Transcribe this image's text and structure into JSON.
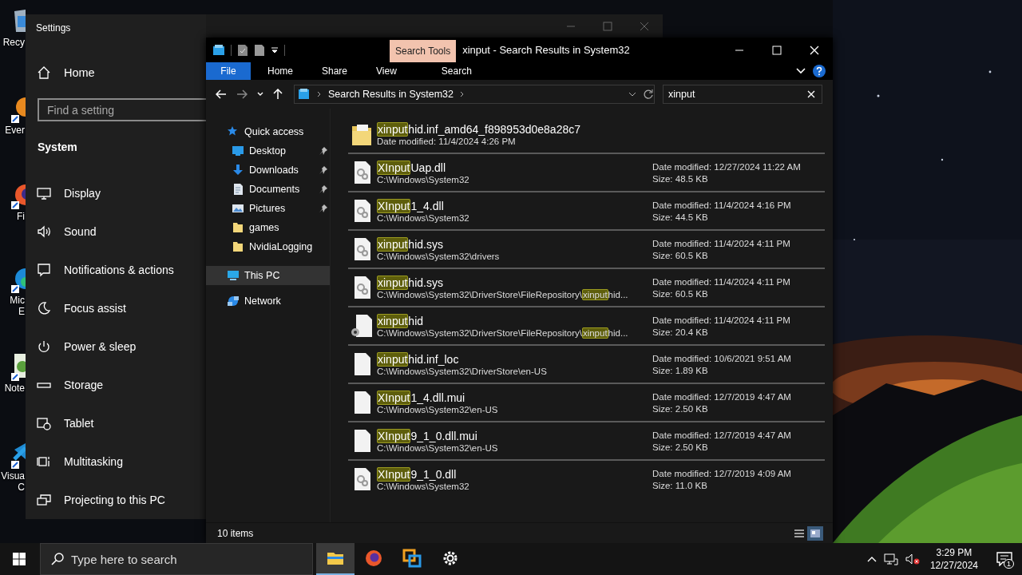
{
  "desktop": {
    "icons": [
      {
        "kind": "bin",
        "lines": [
          "Recy"
        ]
      },
      {
        "kind": "orange",
        "lines": [
          "Ever"
        ]
      },
      {
        "kind": "firefox",
        "lines": [
          "Fi"
        ]
      },
      {
        "kind": "edge",
        "lines": [
          "Mic",
          "E"
        ]
      },
      {
        "kind": "notepad",
        "lines": [
          "Note"
        ]
      },
      {
        "kind": "code",
        "lines": [
          "Visua",
          "C"
        ]
      }
    ]
  },
  "settings": {
    "title": "Settings",
    "home": "Home",
    "search": {
      "placeholder": "Find a setting"
    },
    "section": "System",
    "items": [
      {
        "kind": "display",
        "label": "Display"
      },
      {
        "kind": "sound",
        "label": "Sound"
      },
      {
        "kind": "notifications",
        "label": "Notifications & actions"
      },
      {
        "kind": "focus",
        "label": "Focus assist"
      },
      {
        "kind": "power",
        "label": "Power & sleep"
      },
      {
        "kind": "storage",
        "label": "Storage"
      },
      {
        "kind": "tablet",
        "label": "Tablet"
      },
      {
        "kind": "multitasking",
        "label": "Multitasking"
      },
      {
        "kind": "projecting",
        "label": "Projecting to this PC"
      }
    ]
  },
  "explorer": {
    "context_tab": "Search Tools",
    "title": "xinput - Search Results in System32",
    "ribbon_tabs": [
      {
        "kind": "file",
        "label": "File"
      },
      {
        "kind": "tab",
        "label": "Home"
      },
      {
        "kind": "tab",
        "label": "Share"
      },
      {
        "kind": "tab",
        "label": "View"
      },
      {
        "kind": "context",
        "label": "Search"
      }
    ],
    "address": {
      "crumb": "Search Results in System32"
    },
    "search": {
      "value": "xinput"
    },
    "nav": {
      "items": [
        {
          "kind": "star",
          "label": "Quick access",
          "selected": false,
          "children": [
            {
              "kind": "desktop",
              "label": "Desktop",
              "pinned": true,
              "selected": false
            },
            {
              "kind": "download",
              "label": "Downloads",
              "pinned": true,
              "selected": false
            },
            {
              "kind": "documents",
              "label": "Documents",
              "pinned": true,
              "selected": false
            },
            {
              "kind": "pictures",
              "label": "Pictures",
              "pinned": true,
              "selected": false
            },
            {
              "kind": "folder",
              "label": "games",
              "pinned": false,
              "selected": false
            },
            {
              "kind": "folder",
              "label": "NvidiaLogging",
              "pinned": false,
              "selected": false
            }
          ]
        },
        {
          "kind": "pc",
          "label": "This PC",
          "selected": true
        },
        {
          "kind": "network",
          "label": "Network",
          "selected": false
        }
      ]
    },
    "results": [
      {
        "kind": "folder",
        "name_match": "xinput",
        "name_rest": "hid.inf_amd64_f898953d0e8a28c7",
        "modified": "Date modified: 11/4/2024 4:26 PM"
      },
      {
        "kind": "system",
        "name_match": "XInput",
        "name_rest": "Uap.dll",
        "path": "C:\\Windows\\System32",
        "date": "Date modified: 12/27/2024 11:22 AM",
        "size": "Size: 48.5 KB"
      },
      {
        "kind": "system",
        "name_match": "XInput",
        "name_rest": "1_4.dll",
        "path": "C:\\Windows\\System32",
        "date": "Date modified: 11/4/2024 4:16 PM",
        "size": "Size: 44.5 KB"
      },
      {
        "kind": "system",
        "name_match": "xinput",
        "name_rest": "hid.sys",
        "path": "C:\\Windows\\System32\\drivers",
        "date": "Date modified: 11/4/2024 4:11 PM",
        "size": "Size: 60.5 KB"
      },
      {
        "kind": "system",
        "name_match": "xinput",
        "name_rest": "hid.sys",
        "path": "C:\\Windows\\System32\\DriverStore\\FileRepository\\",
        "path_match": "xinput",
        "path_rest": "hid...",
        "date": "Date modified: 11/4/2024 4:11 PM",
        "size": "Size: 60.5 KB"
      },
      {
        "kind": "setup",
        "name_match": "xinput",
        "name_rest": "hid",
        "path": "C:\\Windows\\System32\\DriverStore\\FileRepository\\",
        "path_match": "xinput",
        "path_rest": "hid...",
        "date": "Date modified: 11/4/2024 4:11 PM",
        "size": "Size: 20.4 KB"
      },
      {
        "kind": "blank",
        "name_match": "xinput",
        "name_rest": "hid.inf_loc",
        "path": "C:\\Windows\\System32\\DriverStore\\en-US",
        "date": "Date modified: 10/6/2021 9:51 AM",
        "size": "Size: 1.89 KB"
      },
      {
        "kind": "blank",
        "name_match": "XInput",
        "name_rest": "1_4.dll.mui",
        "path": "C:\\Windows\\System32\\en-US",
        "date": "Date modified: 12/7/2019 4:47 AM",
        "size": "Size: 2.50 KB"
      },
      {
        "kind": "blank",
        "name_match": "XInput",
        "name_rest": "9_1_0.dll.mui",
        "path": "C:\\Windows\\System32\\en-US",
        "date": "Date modified: 12/7/2019 4:47 AM",
        "size": "Size: 2.50 KB"
      },
      {
        "kind": "system",
        "name_match": "XInput",
        "name_rest": "9_1_0.dll",
        "path": "C:\\Windows\\System32",
        "date": "Date modified: 12/7/2019 4:09 AM",
        "size": "Size: 11.0 KB"
      }
    ],
    "status": {
      "count": "10 items",
      "views": [
        {
          "kind": "details",
          "selected": false
        },
        {
          "kind": "tiles",
          "selected": true
        }
      ]
    }
  },
  "taskbar": {
    "search_placeholder": "Type here to search",
    "apps": [
      {
        "kind": "explorer",
        "active": true
      },
      {
        "kind": "firefox",
        "active": false
      },
      {
        "kind": "boxes",
        "active": false
      },
      {
        "kind": "gear",
        "active": false
      }
    ],
    "time": "3:29 PM",
    "date": "12/27/2024",
    "notifications": "1"
  }
}
